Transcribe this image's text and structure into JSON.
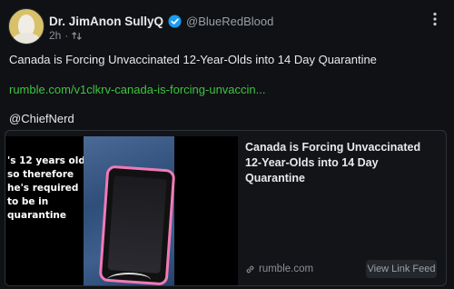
{
  "post": {
    "author": {
      "display_name": "Dr. JimAnon SullyQ",
      "handle": "@BlueRedBlood",
      "verified": true
    },
    "age": "2h",
    "text": "Canada is Forcing Unvaccinated 12-Year-Olds into 14 Day Quarantine",
    "link_text": "rumble.com/v1clkrv-canada-is-forcing-unvaccin...",
    "mention": "@ChiefNerd"
  },
  "card": {
    "thumbnail_caption": "'s 12 years old\nso therefore\nhe's required\nto be in\nquarantine",
    "title": "Canada is Forcing Unvaccinated 12-Year-Olds into 14 Day Quarantine",
    "domain": "rumble.com",
    "button_label": "View Link Feed"
  },
  "icons": {
    "verified": "verified-badge-icon",
    "boost": "boost-icon",
    "more": "more-options-icon",
    "link": "link-icon"
  },
  "colors": {
    "background": "#0f1114",
    "link": "#3fc33f",
    "verified": "#1d9bf0",
    "phone_case": "#ef7bb7"
  }
}
